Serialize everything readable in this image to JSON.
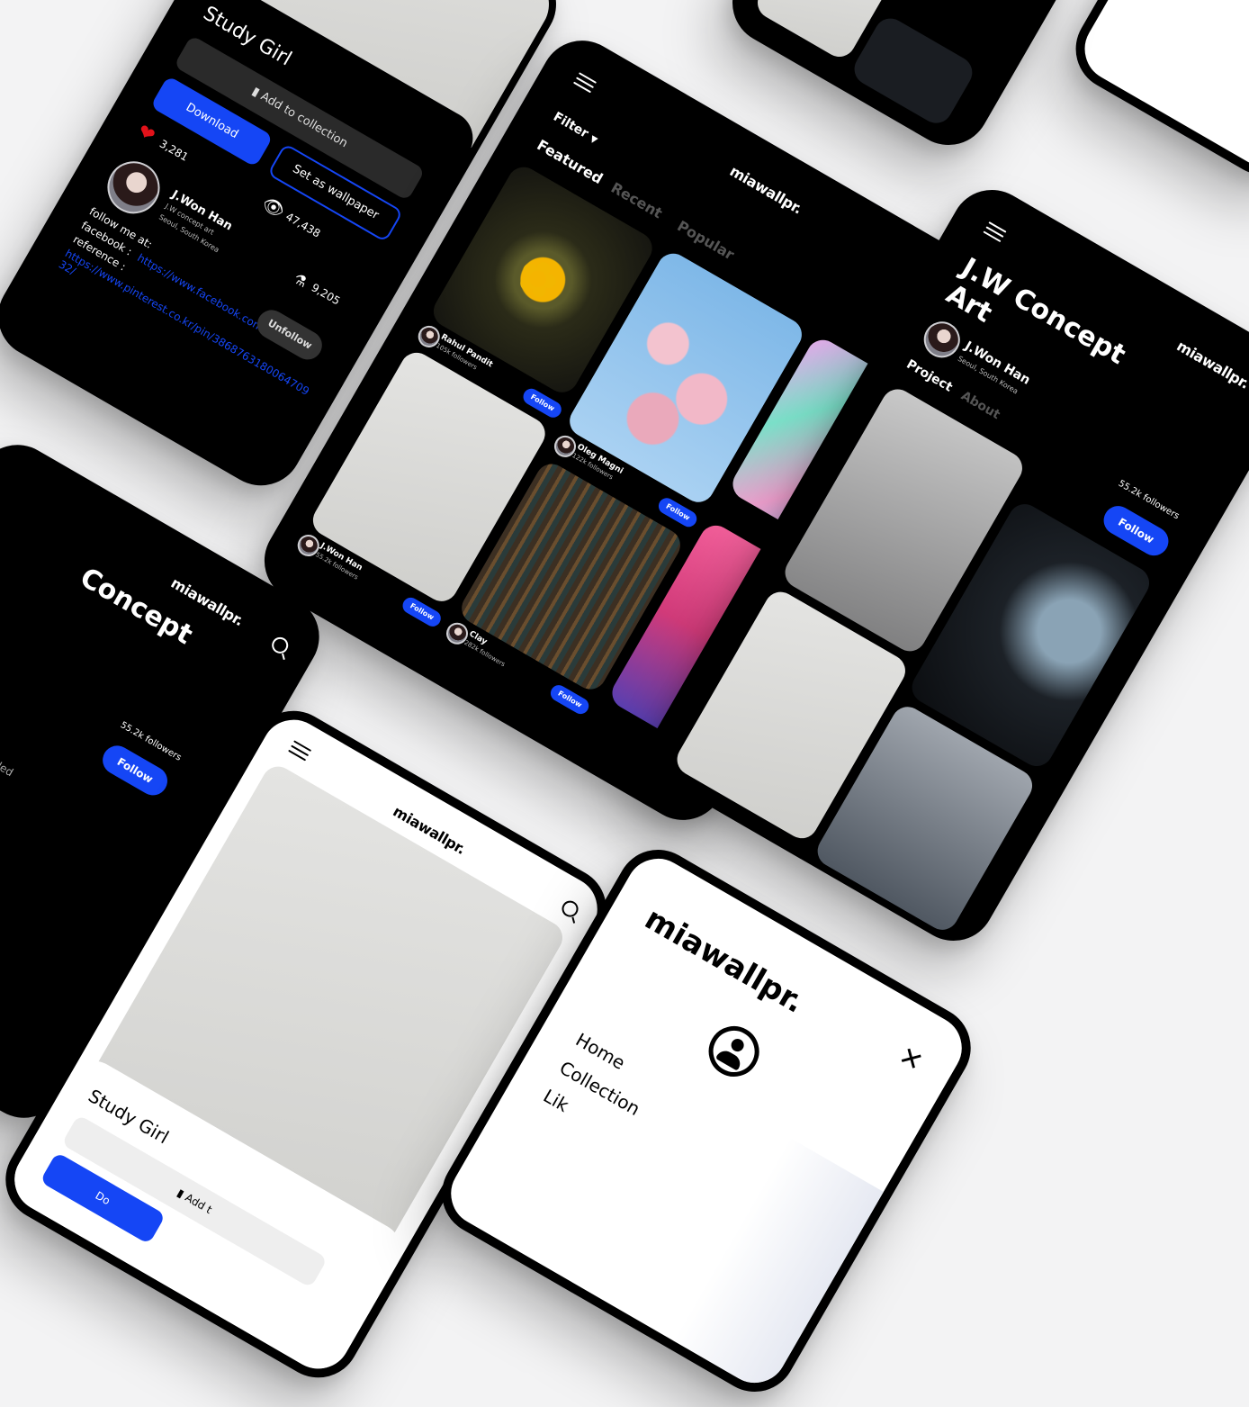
{
  "detail": {
    "title": "Study Girl",
    "add_to_collection": "Add to collection",
    "download": "Download",
    "set_wallpaper": "Set as wallpaper",
    "likes": "3,281",
    "views": "47,438",
    "shares": "9,205",
    "author_name": "J.Won Han",
    "author_sub": "J.W concept art",
    "author_location": "Seoul, South Korea",
    "follow_me": "follow me at:",
    "facebook_label": "facebook :",
    "facebook_url": "https://www.facebook.com/jwhsl0",
    "reference_label": "reference :",
    "reference_url": "https://www.pinterest.co.kr/pin/3868763180064709 32/",
    "unfollow": "Unfollow"
  },
  "feed": {
    "logo": "miawallpr.",
    "filter": "Filter",
    "tabs": [
      "Featured",
      "Recent",
      "Popular"
    ],
    "items": [
      {
        "name": "Rahul Pandit",
        "followers": "105k followers",
        "follow": "Follow"
      },
      {
        "name": "Oleg Magni",
        "followers": "122k followers",
        "follow": "Follow"
      },
      {
        "name": "J.Won Han",
        "followers": "55.2k followers",
        "follow": "Follow"
      },
      {
        "name": "Clay",
        "followers": "282k followers",
        "follow": "Follow"
      }
    ]
  },
  "profile": {
    "logo": "miawallpr.",
    "title": "J.W Concept Art",
    "name": "J.Won Han",
    "location": "Seoul, South Korea",
    "tabs": [
      "Project",
      "About"
    ],
    "followers": "55.2k followers",
    "follow": "Follow"
  },
  "profile_left": {
    "logo": "miawallpr.",
    "title": "Concept",
    "followers": "55.2k followers",
    "follow": "Follow",
    "fragment": "ded"
  },
  "light_detail": {
    "logo": "miawallpr.",
    "title": "Study Girl",
    "add": "Add t",
    "download": "Do"
  },
  "menu": {
    "logo": "miawallpr.",
    "items": [
      "Home",
      "Collection",
      "Lik"
    ]
  },
  "colors": {
    "accent": "#1546f5",
    "heart": "#e2121a",
    "link": "#1546f5"
  }
}
